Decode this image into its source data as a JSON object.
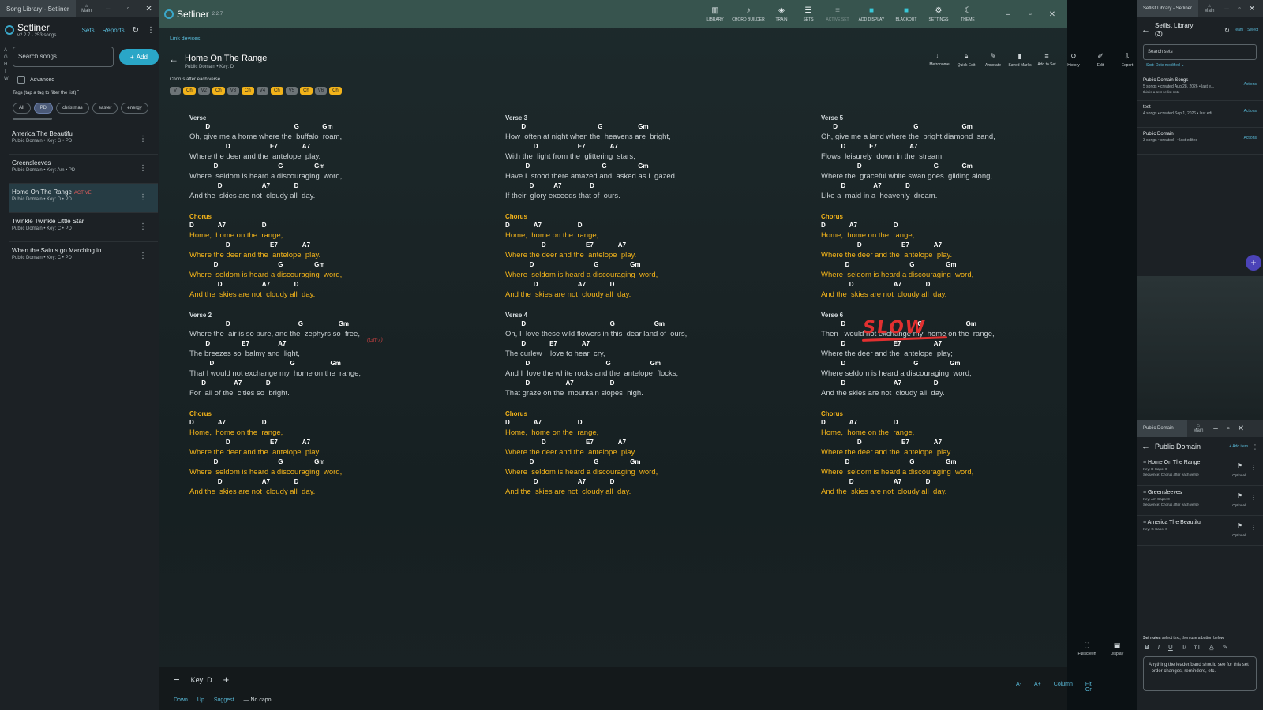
{
  "left_window": {
    "tab_title": "Song Library - Setliner",
    "main_label": "Main",
    "brand": "Setliner",
    "version_info": "v2.2.7 · 253 songs",
    "nav": [
      "Sets",
      "Reports"
    ],
    "alpha_index": [
      "A",
      "G",
      "H",
      "T",
      "W"
    ],
    "search_placeholder": "Search songs",
    "add_label": "Add",
    "advanced_label": "Advanced",
    "tags_hint": "Tags (tap a tag to filter the list)",
    "tags": [
      {
        "label": "All",
        "selected": false
      },
      {
        "label": "PD",
        "selected": true
      },
      {
        "label": "christmas",
        "selected": false
      },
      {
        "label": "easter",
        "selected": false
      },
      {
        "label": "energy",
        "selected": false
      }
    ],
    "songs": [
      {
        "title": "America The Beautiful",
        "meta": "Public Domain • Key: G • PD",
        "active": false
      },
      {
        "title": "Greensleeves",
        "meta": "Public Domain • Key: Am • PD",
        "active": false
      },
      {
        "title": "Home On The Range",
        "meta": "Public Domain • Key: D • PD",
        "active": true,
        "badge": "ACTIVE"
      },
      {
        "title": "Twinkle Twinkle Little Star",
        "meta": "Public Domain • Key: C • PD",
        "active": false
      },
      {
        "title": "When the Saints go Marching in",
        "meta": "Public Domain • Key: C • PD",
        "active": false
      }
    ]
  },
  "main_window": {
    "brand": "Setliner",
    "version": "2.2.7",
    "toolbar": [
      "LIBRARY",
      "CHORD BUILDER",
      "TRAIN",
      "SETS",
      "ACTIVE SET",
      "ADD DISPLAY",
      "BLACKOUT",
      "SETTINGS",
      "THEME"
    ],
    "link_devices": "Link devices",
    "song_title": "Home On The Range",
    "song_meta": "Public Domain  •  Key: D",
    "right_tools": [
      "Metronome",
      "Quick Edit",
      "Annotate",
      "Saved Marks",
      "Add to Set",
      "History",
      "Edit",
      "Export"
    ],
    "sequence_label": "Chorus after each verse",
    "sequence": [
      "V",
      "Ch",
      "V2",
      "Ch",
      "V3",
      "Ch",
      "V4",
      "Ch",
      "V5",
      "Ch",
      "V6",
      "Ch"
    ],
    "annotation_slow": "SLOW",
    "annotation_gm7": "(Gm7)",
    "fullscreen_label": "Fullscreen",
    "display_label": "Display",
    "key_label": "Key: D",
    "key_opts": [
      "Down",
      "Up",
      "Suggest"
    ],
    "capo": "— No capo",
    "view_opts": [
      "A-",
      "A+",
      "Column",
      "Fit: On"
    ]
  },
  "sections": {
    "verse": {
      "title": "Verse",
      "lines": [
        {
          "c": [
            [
              "D",
              4
            ],
            [
              "G",
              26
            ],
            [
              "Gm",
              33
            ]
          ],
          "l": "Oh, give me a home where the  buffalo  roam,"
        },
        {
          "c": [
            [
              "D",
              9
            ],
            [
              "E7",
              20
            ],
            [
              "A7",
              28
            ]
          ],
          "l": "Where the deer and the  antelope  play."
        },
        {
          "c": [
            [
              "D",
              6
            ],
            [
              "G",
              22
            ],
            [
              "Gm",
              31
            ]
          ],
          "l": "Where  seldom is heard a discouraging  word,"
        },
        {
          "c": [
            [
              "D",
              7
            ],
            [
              "A7",
              18
            ],
            [
              "D",
              26
            ]
          ],
          "l": "And the  skies are not  cloudy all  day."
        }
      ]
    },
    "chorus": {
      "title": "Chorus",
      "lines": [
        {
          "c": [
            [
              "D",
              0
            ],
            [
              "A7",
              7
            ],
            [
              "D",
              18
            ]
          ],
          "l": "Home,  home on the  range,"
        },
        {
          "c": [
            [
              "D",
              9
            ],
            [
              "E7",
              20
            ],
            [
              "A7",
              28
            ]
          ],
          "l": "Where the deer and the  antelope  play."
        },
        {
          "c": [
            [
              "D",
              6
            ],
            [
              "G",
              22
            ],
            [
              "Gm",
              31
            ]
          ],
          "l": "Where  seldom is heard a discouraging  word,"
        },
        {
          "c": [
            [
              "D",
              7
            ],
            [
              "A7",
              18
            ],
            [
              "D",
              26
            ]
          ],
          "l": "And the  skies are not  cloudy all  day."
        }
      ]
    },
    "verse2": {
      "title": "Verse 2",
      "lines": [
        {
          "c": [
            [
              "D",
              9
            ],
            [
              "G",
              27
            ],
            [
              "Gm",
              37
            ]
          ],
          "l": "Where the  air is so pure, and the  zephyrs so  free,"
        },
        {
          "c": [
            [
              "D",
              4
            ],
            [
              "E7",
              13
            ],
            [
              "A7",
              22
            ]
          ],
          "l": "The breezes so  balmy and  light,"
        },
        {
          "c": [
            [
              "D",
              5
            ],
            [
              "G",
              25
            ],
            [
              "Gm",
              35
            ]
          ],
          "l": "That I would not exchange my  home on the  range,"
        },
        {
          "c": [
            [
              "D",
              3
            ],
            [
              "A7",
              11
            ],
            [
              "D",
              19
            ]
          ],
          "l": "For  all of the  cities so  bright."
        }
      ]
    },
    "verse3": {
      "title": "Verse 3",
      "lines": [
        {
          "c": [
            [
              "D",
              4
            ],
            [
              "G",
              23
            ],
            [
              "Gm",
              33
            ]
          ],
          "l": "How  often at night when the  heavens are  bright,"
        },
        {
          "c": [
            [
              "D",
              7
            ],
            [
              "E7",
              18
            ],
            [
              "A7",
              26
            ]
          ],
          "l": "With the  light from the  glittering  stars,"
        },
        {
          "c": [
            [
              "D",
              5
            ],
            [
              "G",
              24
            ],
            [
              "Gm",
              33
            ]
          ],
          "l": "Have I  stood there amazed and  asked as I  gazed,"
        },
        {
          "c": [
            [
              "D",
              6
            ],
            [
              "A7",
              12
            ],
            [
              "D",
              21
            ]
          ],
          "l": "If their  glory exceeds that of  ours."
        }
      ]
    },
    "verse4": {
      "title": "Verse 4",
      "lines": [
        {
          "c": [
            [
              "D",
              4
            ],
            [
              "G",
              26
            ],
            [
              "Gm",
              37
            ]
          ],
          "l": "Oh, I  love these wild flowers in this  dear land of  ours,"
        },
        {
          "c": [
            [
              "D",
              4
            ],
            [
              "E7",
              11
            ],
            [
              "A7",
              19
            ]
          ],
          "l": "The curlew I  love to hear  cry,"
        },
        {
          "c": [
            [
              "D",
              5
            ],
            [
              "G",
              25
            ],
            [
              "Gm",
              36
            ]
          ],
          "l": "And I  love the white rocks and the  antelope  flocks,"
        },
        {
          "c": [
            [
              "D",
              5
            ],
            [
              "A7",
              15
            ],
            [
              "D",
              26
            ]
          ],
          "l": "That graze on the  mountain slopes  high."
        }
      ]
    },
    "verse5": {
      "title": "Verse 5",
      "lines": [
        {
          "c": [
            [
              "D",
              3
            ],
            [
              "G",
              23
            ],
            [
              "Gm",
              35
            ]
          ],
          "l": "Oh, give me a land where the  bright diamond  sand,"
        },
        {
          "c": [
            [
              "D",
              5
            ],
            [
              "E7",
              12
            ],
            [
              "A7",
              22
            ]
          ],
          "l": "Flows  leisurely  down in the  stream;"
        },
        {
          "c": [
            [
              "D",
              9
            ],
            [
              "G",
              28
            ],
            [
              "Gm",
              35
            ]
          ],
          "l": "Where the  graceful white swan goes  gliding along,"
        },
        {
          "c": [
            [
              "D",
              5
            ],
            [
              "A7",
              13
            ],
            [
              "D",
              21
            ]
          ],
          "l": "Like a  maid in a  heavenly  dream."
        }
      ]
    },
    "verse6": {
      "title": "Verse 6",
      "lines": [
        {
          "c": [
            [
              "D",
              5
            ],
            [
              "G",
              24
            ],
            [
              "Gm",
              36
            ]
          ],
          "l": "Then I would not exchange my  home on the  range,"
        },
        {
          "c": [
            [
              "D",
              5
            ],
            [
              "E7",
              18
            ],
            [
              "A7",
              28
            ]
          ],
          "l": "Where the deer and the  antelope  play;"
        },
        {
          "c": [
            [
              "D",
              5
            ],
            [
              "G",
              23
            ],
            [
              "Gm",
              32
            ]
          ],
          "l": "Where seldom is heard a discouraging  word,"
        },
        {
          "c": [
            [
              "D",
              5
            ],
            [
              "A7",
              18
            ],
            [
              "D",
              28
            ]
          ],
          "l": "And the skies are not  cloudy all  day."
        }
      ]
    }
  },
  "setlist_library": {
    "tab_title": "Setlist Library - Setliner",
    "main_label": "Main",
    "title": "Setlist Library (3)",
    "links": [
      "Team",
      "Select"
    ],
    "search_placeholder": "Search sets",
    "sort_label": "Sort: Date modified",
    "sets": [
      {
        "title": "Public Domain Songs",
        "meta": "5 songs  •  created Aug 28, 2026  •  last e...",
        "note": "this is a test setlist note",
        "action": "Actions"
      },
      {
        "title": "test",
        "meta": "4 songs  •  created Sep 1, 2026  •  last edi...",
        "note": "",
        "action": "Actions"
      },
      {
        "title": "Public Domain",
        "meta": "3 songs  •  created  -  •  last edited -",
        "note": "",
        "action": "Actions"
      }
    ]
  },
  "public_domain_window": {
    "tab_title": "Public Domain",
    "main_label": "Main",
    "title": "Public Domain",
    "add_item": "+ Add item",
    "items": [
      {
        "title": "Home On The Range",
        "meta": "Key: D   Capo: 0",
        "seq": "Sequence: Chorus after each verse",
        "opt": "Optional"
      },
      {
        "title": "Greensleeves",
        "meta": "Key: Am   Capo: 0",
        "seq": "Sequence: Chorus after each verse",
        "opt": "Optional"
      },
      {
        "title": "America The Beautiful",
        "meta": "Key: G   Capo: 0",
        "seq": "",
        "opt": "Optional"
      }
    ],
    "notes_label": "Set notes",
    "notes_hint": "select text, then use a button below",
    "notes_text": "Anything the leader/band should see for this set - order changes, reminders, etc."
  }
}
